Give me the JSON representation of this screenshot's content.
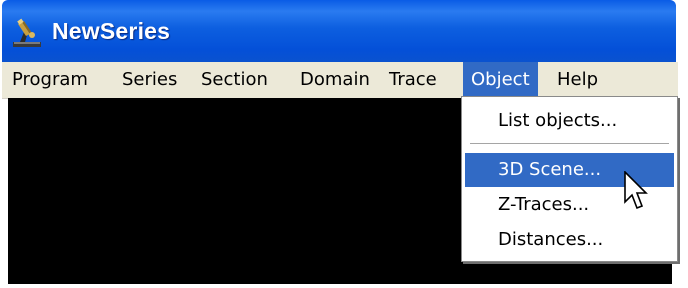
{
  "window": {
    "title": "NewSeries",
    "icon": "microscope-icon"
  },
  "menubar": {
    "items": [
      "Program",
      "Series",
      "Section",
      "Domain",
      "Trace",
      "Object",
      "Help"
    ],
    "active": "Object"
  },
  "dropdown": {
    "items": [
      {
        "label": "List objects..."
      },
      {
        "label": "3D Scene...",
        "highlighted": true
      },
      {
        "label": "Z-Traces..."
      },
      {
        "label": "Distances..."
      }
    ]
  },
  "cursor": "arrow-cursor-icon",
  "colors": {
    "titlebar": "#0450d8",
    "menubar": "#ece9d8",
    "highlight": "#316ac5",
    "canvas": "#000000"
  }
}
